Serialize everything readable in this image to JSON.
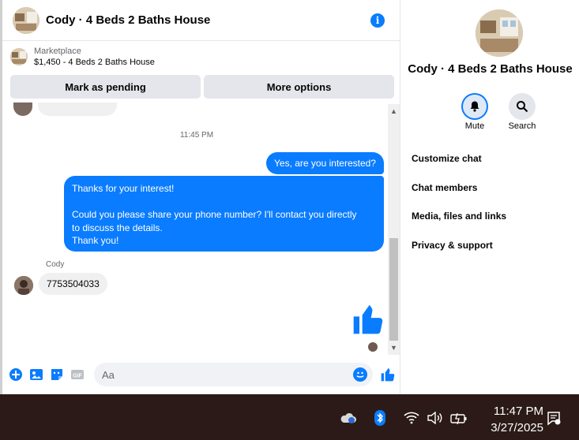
{
  "header": {
    "title": "Cody · 4 Beds 2 Baths House"
  },
  "listing": {
    "label": "Marketplace",
    "item": "$1,450 - 4 Beds 2 Baths House"
  },
  "actions": {
    "pending_label": "Mark as pending",
    "more_label": "More options"
  },
  "conversation": {
    "timestamp": "11:45 PM",
    "outgoing_short": "Yes, are you interested?",
    "outgoing_long": [
      "Thanks for your interest!",
      "",
      "Could you please share your phone number? I'll contact you directly",
      "to discuss the details.",
      "Thank you!"
    ],
    "sender_name": "Cody",
    "incoming": "7753504033"
  },
  "composer": {
    "placeholder": "Aa",
    "icons": [
      "plus-icon",
      "image-icon",
      "sticker-icon",
      "gif-icon",
      "emoji-icon",
      "thumbs-up-icon"
    ]
  },
  "info_pane": {
    "title": "Cody · 4 Beds 2 Baths House",
    "mute_label": "Mute",
    "search_label": "Search",
    "items": [
      "Customize chat",
      "Chat members",
      "Media, files and links",
      "Privacy & support"
    ]
  },
  "taskbar": {
    "time": "11:47 PM",
    "date": "3/27/2025"
  },
  "colors": {
    "accent": "#0a7cff",
    "taskbar": "#2b1a17"
  }
}
